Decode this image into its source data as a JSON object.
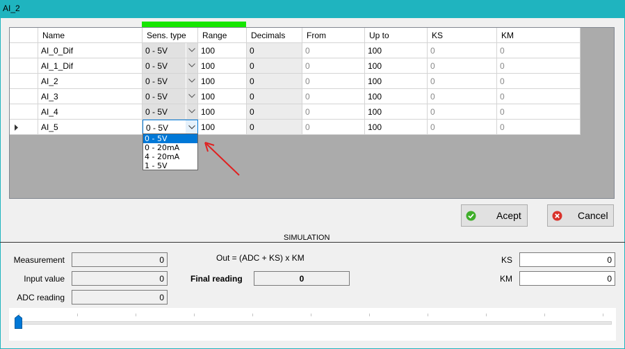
{
  "window": {
    "title": "AI_2"
  },
  "table": {
    "columns": [
      "",
      "Name",
      "Sens. type",
      "Range",
      "Decimals",
      "From",
      "Up to",
      "KS",
      "KM"
    ],
    "rows": [
      {
        "name": "AI_0_Dif",
        "sens_type": "0 - 5V",
        "range": "100",
        "decimals": "0",
        "from": "0",
        "up_to": "100",
        "ks": "0",
        "km": "0"
      },
      {
        "name": "AI_1_Dif",
        "sens_type": "0 - 5V",
        "range": "100",
        "decimals": "0",
        "from": "0",
        "up_to": "100",
        "ks": "0",
        "km": "0"
      },
      {
        "name": "AI_2",
        "sens_type": "0 - 5V",
        "range": "100",
        "decimals": "0",
        "from": "0",
        "up_to": "100",
        "ks": "0",
        "km": "0"
      },
      {
        "name": "AI_3",
        "sens_type": "0 - 5V",
        "range": "100",
        "decimals": "0",
        "from": "0",
        "up_to": "100",
        "ks": "0",
        "km": "0"
      },
      {
        "name": "AI_4",
        "sens_type": "0 - 5V",
        "range": "100",
        "decimals": "0",
        "from": "0",
        "up_to": "100",
        "ks": "0",
        "km": "0"
      },
      {
        "name": "AI_5",
        "sens_type": "0 - 5V",
        "range": "100",
        "decimals": "0",
        "from": "0",
        "up_to": "100",
        "ks": "0",
        "km": "0"
      }
    ],
    "dropdown_options": [
      "0 - 5V",
      "0 - 20mA",
      "4 - 20mA",
      "1 - 5V"
    ],
    "selected_option": "0 - 5V"
  },
  "buttons": {
    "accept": "Acept",
    "cancel": "Cancel"
  },
  "simulation": {
    "section_label": "SIMULATION",
    "measurement_label": "Measurement",
    "measurement_value": "0",
    "input_label": "Input value",
    "input_value": "0",
    "adc_label": "ADC reading",
    "adc_value": "0",
    "formula": "Out = (ADC + KS) x KM",
    "final_label": "Final reading",
    "final_value": "0",
    "ks_label": "KS",
    "ks_value": "0",
    "km_label": "KM",
    "km_value": "0",
    "slider_value": 0
  },
  "colors": {
    "titlebar": "#1fb4bf",
    "status_bar": "#16e600",
    "selection": "#0078d7",
    "annotation_arrow": "#e02020"
  },
  "icons": {
    "accept": "check-circle-icon",
    "cancel": "x-circle-icon",
    "row_selector": "row-pointer-icon"
  }
}
